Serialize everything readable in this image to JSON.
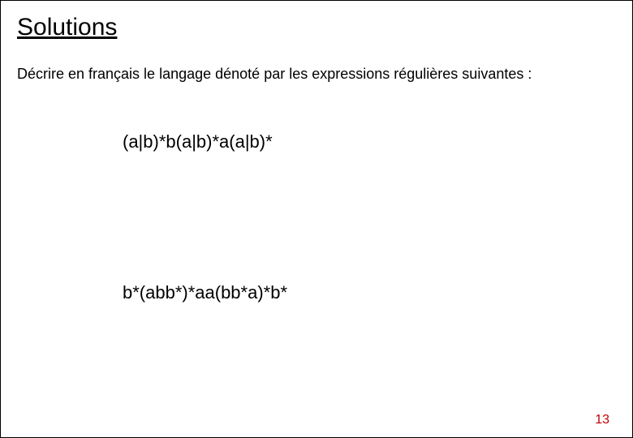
{
  "title": "Solutions",
  "prompt": "Décrire en français le langage dénoté par les expressions régulières suivantes :",
  "expressions": {
    "first": "(a|b)*b(a|b)*a(a|b)*",
    "second": "b*(abb*)*aa(bb*a)*b*"
  },
  "page_number": "13"
}
